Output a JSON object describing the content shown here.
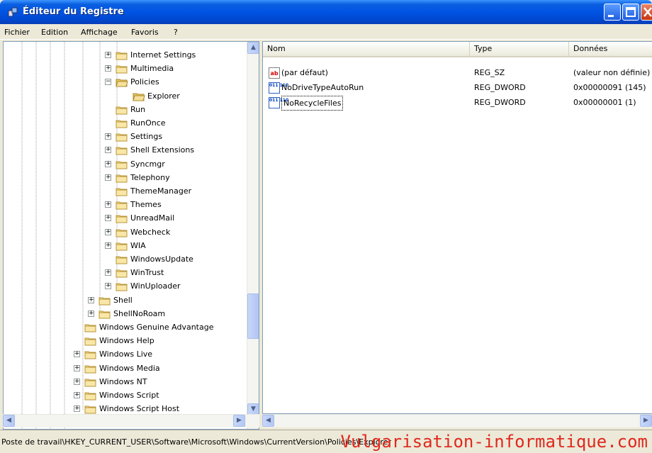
{
  "window": {
    "title": "Éditeur du Registre"
  },
  "menu": [
    "Fichier",
    "Edition",
    "Affichage",
    "Favoris",
    "?"
  ],
  "tree": [
    {
      "label": "Internet Settings",
      "expander": "+"
    },
    {
      "label": "Multimedia",
      "expander": "+"
    },
    {
      "label": "Policies",
      "expander": "−"
    },
    {
      "label": "Explorer",
      "expander": ""
    },
    {
      "label": "Run",
      "expander": ""
    },
    {
      "label": "RunOnce",
      "expander": ""
    },
    {
      "label": "Settings",
      "expander": "+"
    },
    {
      "label": "Shell Extensions",
      "expander": "+"
    },
    {
      "label": "Syncmgr",
      "expander": "+"
    },
    {
      "label": "Telephony",
      "expander": "+"
    },
    {
      "label": "ThemeManager",
      "expander": ""
    },
    {
      "label": "Themes",
      "expander": "+"
    },
    {
      "label": "UnreadMail",
      "expander": "+"
    },
    {
      "label": "Webcheck",
      "expander": "+"
    },
    {
      "label": "WIA",
      "expander": "+"
    },
    {
      "label": "WindowsUpdate",
      "expander": ""
    },
    {
      "label": "WinTrust",
      "expander": "+"
    },
    {
      "label": "WinUploader",
      "expander": "+"
    },
    {
      "label": "Shell",
      "expander": "+"
    },
    {
      "label": "ShellNoRoam",
      "expander": "+"
    },
    {
      "label": "Windows Genuine Advantage",
      "expander": ""
    },
    {
      "label": "Windows Help",
      "expander": ""
    },
    {
      "label": "Windows Live",
      "expander": "+"
    },
    {
      "label": "Windows Media",
      "expander": "+"
    },
    {
      "label": "Windows NT",
      "expander": "+"
    },
    {
      "label": "Windows Script",
      "expander": "+"
    },
    {
      "label": "Windows Script Host",
      "expander": "+"
    }
  ],
  "list": {
    "columns": [
      "Nom",
      "Type",
      "Données"
    ],
    "rows": [
      {
        "name": "(par défaut)",
        "type": "REG_SZ",
        "data": "(valeur non définie)",
        "icon": "ab"
      },
      {
        "name": "NoDriveTypeAutoRun",
        "type": "REG_DWORD",
        "data": "0x00000091 (145)",
        "icon": "011\n110"
      },
      {
        "name": "NoRecycleFiles",
        "type": "REG_DWORD",
        "data": "0x00000001 (1)",
        "icon": "011\n110"
      }
    ]
  },
  "status": {
    "path": "Poste de travail\\HKEY_CURRENT_USER\\Software\\Microsoft\\Windows\\CurrentVersion\\Policies\\Explorer"
  },
  "watermark": "Vulgarisation-informatique.com",
  "icons": {
    "app": "registry-editor-icon",
    "folder": "folder-icon",
    "open_folder": "folder-open-icon",
    "string_value": "string-value-icon",
    "binary_value": "dword-value-icon"
  }
}
